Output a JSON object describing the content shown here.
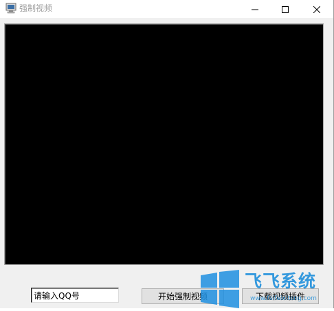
{
  "window": {
    "title": "强制视频",
    "app_icon": "computer-monitor-icon",
    "controls": {
      "minimize_icon": "minimize-icon",
      "maximize_icon": "maximize-icon",
      "close_icon": "close-icon"
    }
  },
  "video": {
    "background_color": "#000000"
  },
  "form": {
    "qq_input_value": "请输入QQ号",
    "start_button_label": "开始强制视频",
    "download_button_label": "下载视频插件"
  },
  "watermark": {
    "brand": "飞飞系统",
    "url": "www.feifeixitong.com",
    "logo_icon": "windows-logo-icon",
    "color": "#0a85d9"
  }
}
